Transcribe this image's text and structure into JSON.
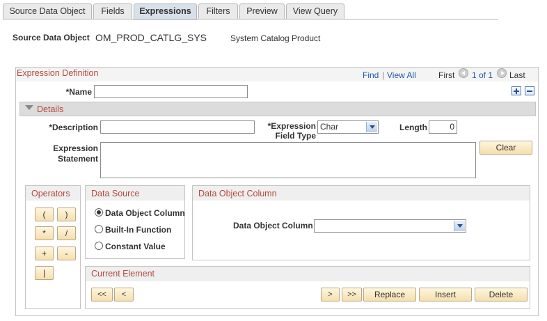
{
  "tabs": [
    {
      "label": "Source Data Object"
    },
    {
      "label": "Fields"
    },
    {
      "label": "Expressions"
    },
    {
      "label": "Filters"
    },
    {
      "label": "Preview"
    },
    {
      "label": "View Query"
    }
  ],
  "source": {
    "label": "Source Data Object",
    "value": "OM_PROD_CATLG_SYS",
    "description": "System Catalog Product"
  },
  "expression_definition": {
    "title": "Expression Definition",
    "find": "Find",
    "separator": "|",
    "view_all": "View All",
    "first": "First",
    "range": "1 of 1",
    "last": "Last",
    "name_label": "*Name",
    "name_value": "",
    "add_icon": "plus-icon",
    "remove_icon": "minus-icon"
  },
  "details": {
    "title": "Details",
    "description_label": "*Description",
    "description_value": "",
    "field_type_label_1": "*Expression",
    "field_type_label_2": "Field Type",
    "field_type_value": "Char",
    "length_label": "Length",
    "length_value": "0",
    "statement_label_1": "Expression",
    "statement_label_2": "Statement",
    "statement_value": "",
    "clear_button": "Clear"
  },
  "operators": {
    "title": "Operators",
    "buttons": [
      "(",
      ")",
      "*",
      "/",
      "+",
      "-",
      "|"
    ]
  },
  "data_source": {
    "title": "Data Source",
    "options": [
      {
        "label": "Data Object Column",
        "selected": true
      },
      {
        "label": "Built-In Function",
        "selected": false
      },
      {
        "label": "Constant Value",
        "selected": false
      }
    ]
  },
  "data_object_column": {
    "title": "Data Object Column",
    "label": "Data Object Column",
    "value": ""
  },
  "current_element": {
    "title": "Current Element",
    "first_btn": "<<",
    "prev_btn": "<",
    "next_btn": ">",
    "last_btn": ">>",
    "replace_btn": "Replace",
    "insert_btn": "Insert",
    "delete_btn": "Delete"
  },
  "colors": {
    "section_title": "#b6483e",
    "link": "#1e5aa8",
    "button_fill": "#f5dfac"
  }
}
